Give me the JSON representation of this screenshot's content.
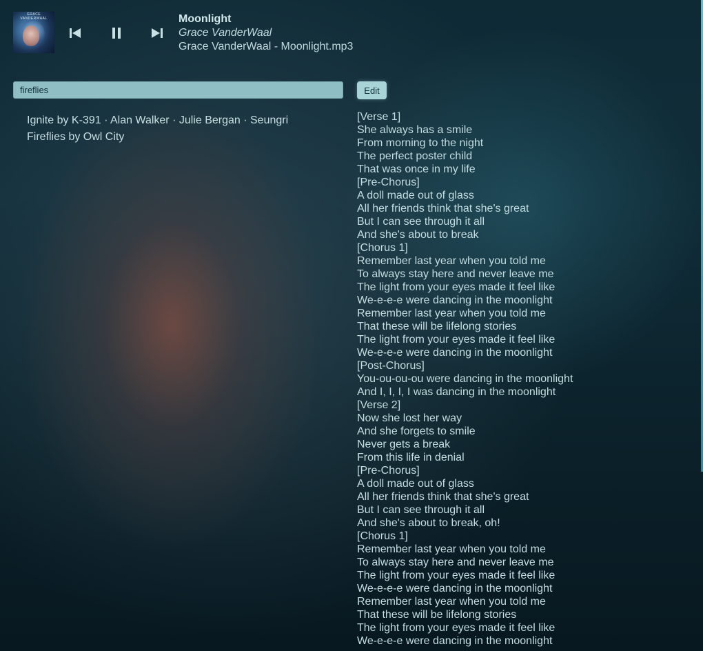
{
  "player": {
    "cover_text": "GRACE VANDERWAAL",
    "title": "Moonlight",
    "artist": "Grace VanderWaal",
    "file": "Grace VanderWaal - Moonlight.mp3",
    "controls": {
      "previous_icon": "skip-previous-icon",
      "pause_icon": "pause-icon",
      "next_icon": "skip-next-icon"
    }
  },
  "search": {
    "value": "fireflies",
    "placeholder": ""
  },
  "results": [
    "Ignite by K-391 · Alan Walker · Julie Bergan · Seungri",
    "Fireflies by Owl City"
  ],
  "edit_label": "Edit",
  "lyrics": [
    "[Verse 1]",
    "She always has a smile",
    "From morning to the night",
    "The perfect poster child",
    "That was once in my life",
    "[Pre-Chorus]",
    "A doll made out of glass",
    "All her friends think that she's great",
    "But I can see through it all",
    "And she's about to break",
    "[Chorus 1]",
    "Remember last year when you told me",
    "To always stay here and never leave me",
    "The light from your eyes made it feel like",
    "We-e-e-e were dancing in the moonlight",
    "Remember last year when you told me",
    "That these will be lifelong stories",
    "The light from your eyes made it feel like",
    "We-e-e-e were dancing in the moonlight",
    "[Post-Chorus]",
    "You-ou-ou-ou were dancing in the moonlight",
    "And I, I, I, I was dancing in the moonlight",
    "[Verse 2]",
    "Now she lost her way",
    "And she forgets to smile",
    "Never gets a break",
    "From this life in denial",
    "[Pre-Chorus]",
    "A doll made out of glass",
    "All her friends think that she's great",
    "But I can see through it all",
    "And she's about to break, oh!",
    "[Chorus 1]",
    "Remember last year when you told me",
    "To always stay here and never leave me",
    "The light from your eyes made it feel like",
    "We-e-e-e were dancing in the moonlight",
    "Remember last year when you told me",
    "That these will be lifelong stories",
    "The light from your eyes made it feel like",
    "We-e-e-e were dancing in the moonlight"
  ],
  "colors": {
    "accent": "#8fbfc5",
    "text": "#c3dde1",
    "background": "#0d222c"
  }
}
